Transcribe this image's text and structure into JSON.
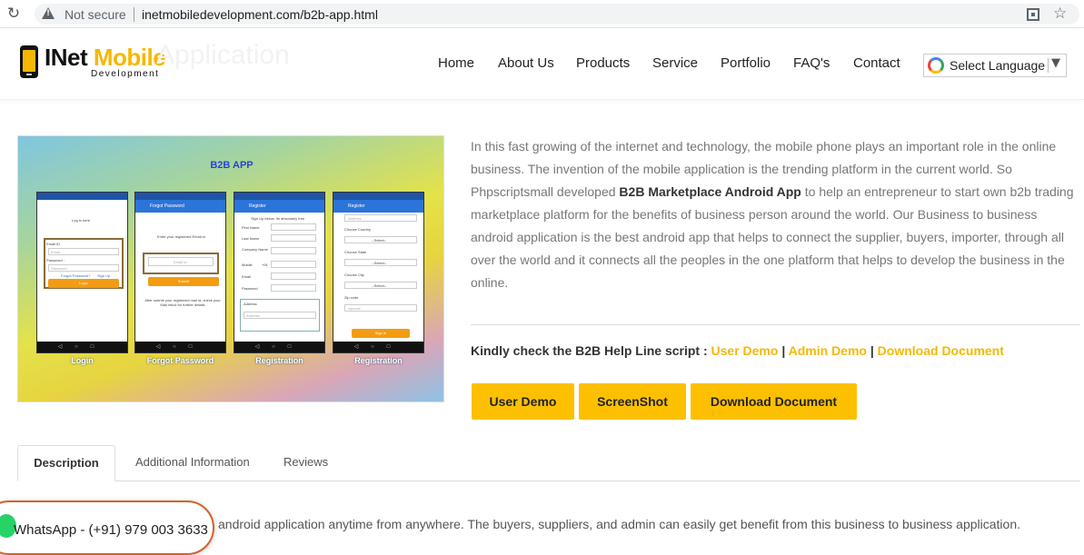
{
  "browser": {
    "security_label": "Not secure",
    "url": "inetmobiledevelopment.com/b2b-app.html"
  },
  "header": {
    "logo_part1": "INet ",
    "logo_part2": "Mobile",
    "logo_sub": "Development",
    "ghost_title": "Application",
    "nav": [
      "Home",
      "About Us",
      "Products",
      "Service",
      "Portfolio",
      "FAQ's",
      "Contact"
    ],
    "language_label": "Select Language",
    "language_caret": "▼"
  },
  "product_image": {
    "title": "B2B APP",
    "screens": [
      {
        "bar": "",
        "caption": "Login",
        "texts": [
          "Log in here",
          "Email ID",
          "Email",
          "Password :",
          "Password",
          "Forgot Password?",
          "Sign Up"
        ],
        "button": "Login"
      },
      {
        "bar": "Forgot Password",
        "caption": "Forgot Password",
        "texts": [
          "Enter your registered Email id",
          "Email Id",
          "After submit your registered mail id, check your Mail inbox for further details"
        ],
        "button": "Submit"
      },
      {
        "bar": "Register",
        "caption": "Registration",
        "texts": [
          "Sign Up below. Its absolutely free",
          "First Name",
          "Last Name",
          "Company Name",
          "Mobile",
          "+91",
          "Email",
          "Password",
          "Address",
          "Address"
        ],
        "button": ""
      },
      {
        "bar": "Register",
        "caption": "Registration",
        "texts": [
          "Address",
          "Choose Country",
          "--Select--",
          "Choose State",
          "--Select--",
          "Choose City",
          "--Select--",
          "Zip code",
          "zipcode"
        ],
        "button": "Sign In"
      }
    ]
  },
  "description": {
    "part1": "In this fast growing of the internet and technology, the mobile phone plays an important role in the online business. The invention of the mobile application is the trending platform in the current world. So Phpscriptsmall developed ",
    "bold": "B2B Marketplace Android App",
    "part2": " to help an entrepreneur to start own b2b trading marketplace platform for the benefits of business person around the world. Our Business to business android application is the best android app that helps to connect the supplier, buyers, importer, through all over the world and it connects all the peoples in the one platform that helps to develop the business in the online."
  },
  "helpline": {
    "label": "Kindly check the B2B Help Line script : ",
    "user_demo": "User Demo",
    "sep1": " | ",
    "admin_demo": "Admin Demo",
    "sep2": " | ",
    "download": "Download Document"
  },
  "buttons": {
    "user_demo": "User Demo",
    "screenshot": "ScreenShot",
    "download": "Download Document"
  },
  "tabs": {
    "description": "Description",
    "additional": "Additional Information",
    "reviews": "Reviews"
  },
  "bottom_text": "android application anytime from anywhere. The buyers, suppliers, and admin can easily get benefit from this business to business application.",
  "whatsapp": {
    "label": "WhatsApp - (+91) 979 003 3633"
  },
  "colors": {
    "accent": "#fcc000",
    "link": "#f5b800",
    "whatsapp_border": "#d4622a"
  }
}
